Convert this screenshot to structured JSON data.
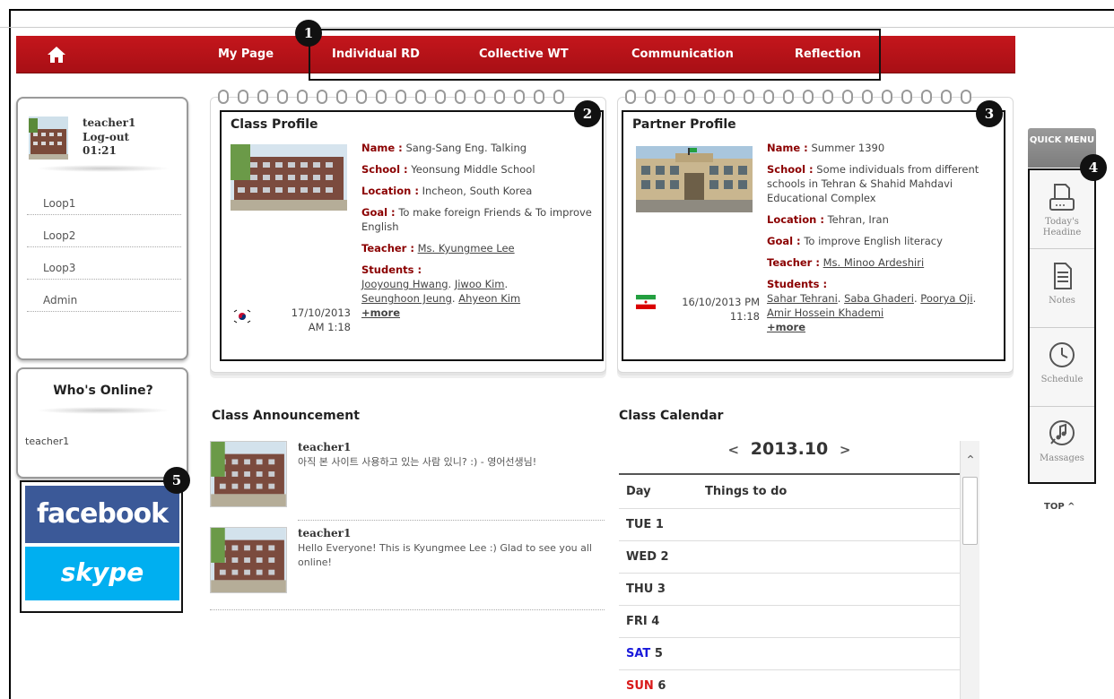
{
  "nav": {
    "items": [
      "My Page",
      "Individual RD",
      "Collective WT",
      "Communication",
      "Reflection"
    ]
  },
  "callouts": [
    "1",
    "2",
    "3",
    "4",
    "5"
  ],
  "user": {
    "name": "teacher1",
    "logout": "Log-out",
    "time": "01:21",
    "loops": [
      "Loop1",
      "Loop2",
      "Loop3",
      "Admin"
    ]
  },
  "online": {
    "title": "Who's Online?",
    "users": [
      "teacher1"
    ]
  },
  "social": {
    "facebook": "facebook",
    "skype": "skype"
  },
  "class_profile": {
    "title": "Class Profile",
    "name_label": "Name :",
    "name": "Sang-Sang Eng. Talking",
    "school_label": "School :",
    "school": "Yeonsung Middle School",
    "location_label": "Location :",
    "location": "Incheon, South Korea",
    "goal_label": "Goal :",
    "goal": "To make foreign Friends & To improve English",
    "teacher_label": "Teacher :",
    "teacher": "Ms. Kyungmee Lee",
    "students_label": "Students :",
    "students": [
      "Jooyoung Hwang",
      "Jiwoo Kim",
      "Seunghoon Jeung",
      "Ahyeon Kim"
    ],
    "more": "+more",
    "date": "17/10/2013",
    "time": "AM 1:18"
  },
  "partner_profile": {
    "title": "Partner Profile",
    "name_label": "Name :",
    "name": "Summer 1390",
    "school_label": "School :",
    "school": "Some individuals from different schools in Tehran & Shahid Mahdavi Educational Complex",
    "location_label": "Location :",
    "location": "Tehran, Iran",
    "goal_label": "Goal :",
    "goal": "To improve English literacy",
    "teacher_label": "Teacher :",
    "teacher": "Ms. Minoo Ardeshiri",
    "students_label": "Students :",
    "students": [
      "Sahar Tehrani",
      "Saba Ghaderi",
      "Poorya Oji",
      "Amir Hossein Khademi"
    ],
    "more": "+more",
    "date": "16/10/2013 PM",
    "time": "11:18"
  },
  "announcements": {
    "title": "Class Announcement",
    "items": [
      {
        "author": "teacher1",
        "text": "아직 본 사이트 사용하고 있는 사람 있니? :) - 영어선생님!"
      },
      {
        "author": "teacher1",
        "text": "Hello Everyone! This is Kyungmee Lee :) Glad to see you all online!"
      }
    ]
  },
  "calendar": {
    "title": "Class Calendar",
    "prev": "<",
    "month": "2013.10",
    "next": ">",
    "col_day": "Day",
    "col_todo": "Things to do",
    "days": [
      {
        "label": "TUE",
        "num": "1",
        "color": "#333333"
      },
      {
        "label": "WED",
        "num": "2",
        "color": "#333333"
      },
      {
        "label": "THU",
        "num": "3",
        "color": "#333333"
      },
      {
        "label": "FRI",
        "num": "4",
        "color": "#333333"
      },
      {
        "label": "SAT",
        "num": "5",
        "color": "#1a1adb"
      },
      {
        "label": "SUN",
        "num": "6",
        "color": "#d91a1a"
      }
    ]
  },
  "quick_menu": {
    "title": "QUICK MENU",
    "items": [
      "Today's Headine",
      "Notes",
      "Schedule",
      "Massages"
    ],
    "top": "TOP ^"
  },
  "colors": {
    "nav": "#c4161c",
    "label": "#8b0000",
    "facebook": "#3b5998",
    "skype": "#00aff0"
  }
}
